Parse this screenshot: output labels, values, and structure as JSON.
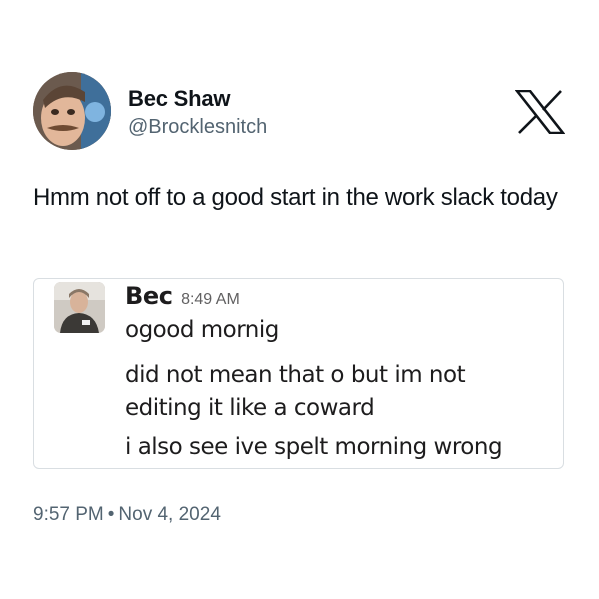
{
  "author": {
    "display_name": "Bec Shaw",
    "handle": "@Brocklesnitch",
    "avatar_icon": "profile-photo"
  },
  "platform": {
    "logo_icon": "x-logo",
    "color": "#0f1419"
  },
  "tweet": {
    "text": "Hmm not off to a good start in the work slack today"
  },
  "slack_embed": {
    "sender": "Bec",
    "time": "8:49 AM",
    "messages": [
      "ogood mornig",
      "did not mean that o but im not\nediting it like a coward",
      "i also see ive spelt morning wrong"
    ]
  },
  "meta": {
    "time": "9:57 PM",
    "separator": "•",
    "date": "Nov 4, 2024"
  },
  "colors": {
    "text": "#0f1419",
    "secondary": "#536471",
    "slack_text": "#1d1c1d",
    "card_border": "#d9dee2"
  }
}
